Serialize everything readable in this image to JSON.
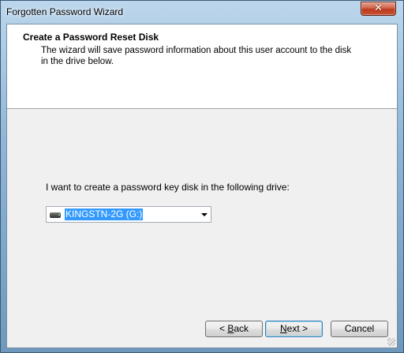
{
  "window": {
    "title": "Forgotten Password Wizard",
    "close_glyph": "✕"
  },
  "header": {
    "title": "Create a Password Reset Disk",
    "description": "The wizard will save password information about this user account to the disk in the drive below."
  },
  "body": {
    "prompt_label": "I want to create a password key disk in the following drive:",
    "drive_select": {
      "selected_value": "KINGSTN-2G (G:)",
      "icon": "usb-drive-icon"
    }
  },
  "buttons": {
    "back": {
      "mnemonic": "B",
      "rest": "ack",
      "label": "< Back"
    },
    "next": {
      "mnemonic": "N",
      "rest": "ext >",
      "label": "Next >"
    },
    "cancel": {
      "label": "Cancel"
    }
  }
}
